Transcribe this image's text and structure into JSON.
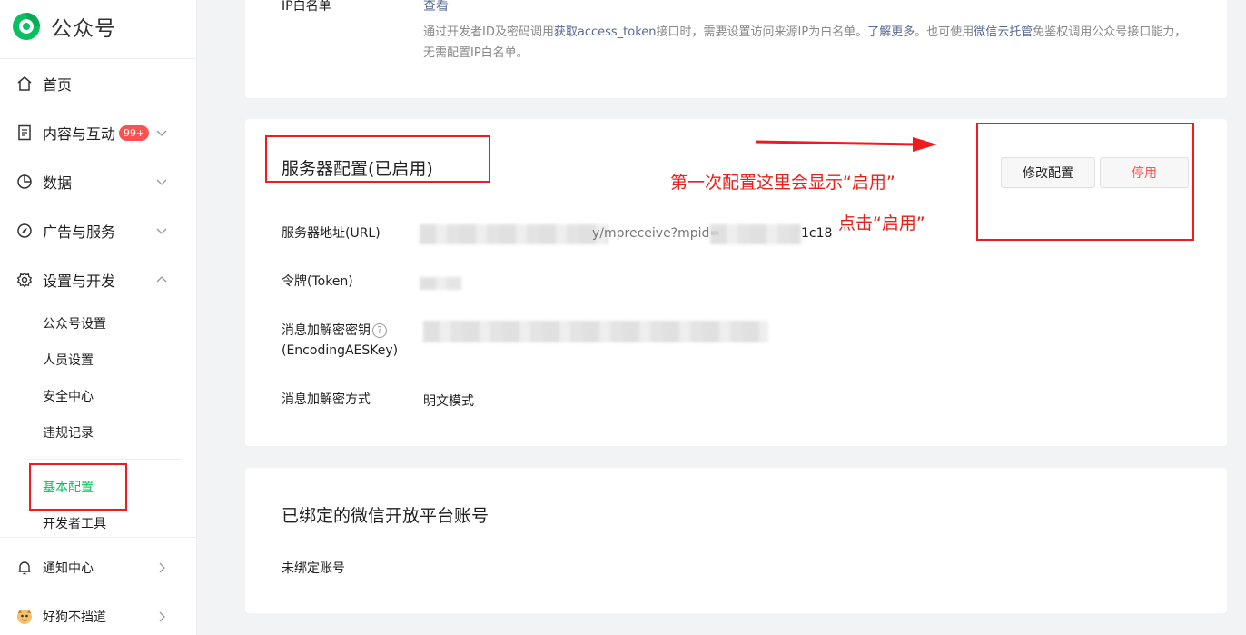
{
  "sidebar": {
    "logo_text": "公众号",
    "items": [
      {
        "label": "首页",
        "icon": "home-icon"
      },
      {
        "label": "内容与互动",
        "icon": "document-icon",
        "badge": "99+"
      },
      {
        "label": "数据",
        "icon": "pie-chart-icon"
      },
      {
        "label": "广告与服务",
        "icon": "compass-icon"
      },
      {
        "label": "设置与开发",
        "icon": "gear-icon"
      },
      {
        "label": "通知中心",
        "icon": "bell-icon"
      },
      {
        "label": "好狗不挡道",
        "icon": "avatar"
      }
    ],
    "sub_items": [
      "公众号设置",
      "人员设置",
      "安全中心",
      "违规记录",
      "基本配置",
      "开发者工具"
    ],
    "active_sub": "基本配置"
  },
  "ip_whitelist": {
    "label": "IP白名单",
    "link": "查看",
    "desc_1": "通过开发者ID及密码调用",
    "desc_link_1": "获取access_token",
    "desc_2": "接口时，需要设置访问来源IP为白名单。",
    "desc_link_2": "了解更多",
    "desc_3": "。也可使用",
    "desc_link_3": "微信云托管",
    "desc_4": "免鉴权调用公众号接口能力，无需配置IP白名单。"
  },
  "server_config": {
    "title": "服务器配置(已启用)",
    "buttons": {
      "modify": "修改配置",
      "stop": "停用"
    },
    "rows": [
      {
        "label": "服务器地址(URL)",
        "value_visible": "y/mpreceive?mpid=",
        "value_tail": "1c18"
      },
      {
        "label": "令牌(Token)"
      },
      {
        "label_line1": "消息加解密密钥",
        "help": "?",
        "label_line2": "(EncodingAESKey)"
      },
      {
        "label": "消息加解密方式",
        "value": "明文模式"
      }
    ]
  },
  "bound_accounts": {
    "title": "已绑定的微信开放平台账号",
    "value": "未绑定账号"
  },
  "annotations": {
    "note_1": "第一次配置这里会显示“启用”",
    "note_2": "点击“启用”"
  },
  "colors": {
    "accent": "#07c160",
    "danger": "#fa5151",
    "link": "#576b95",
    "annotation": "#e8201a"
  }
}
